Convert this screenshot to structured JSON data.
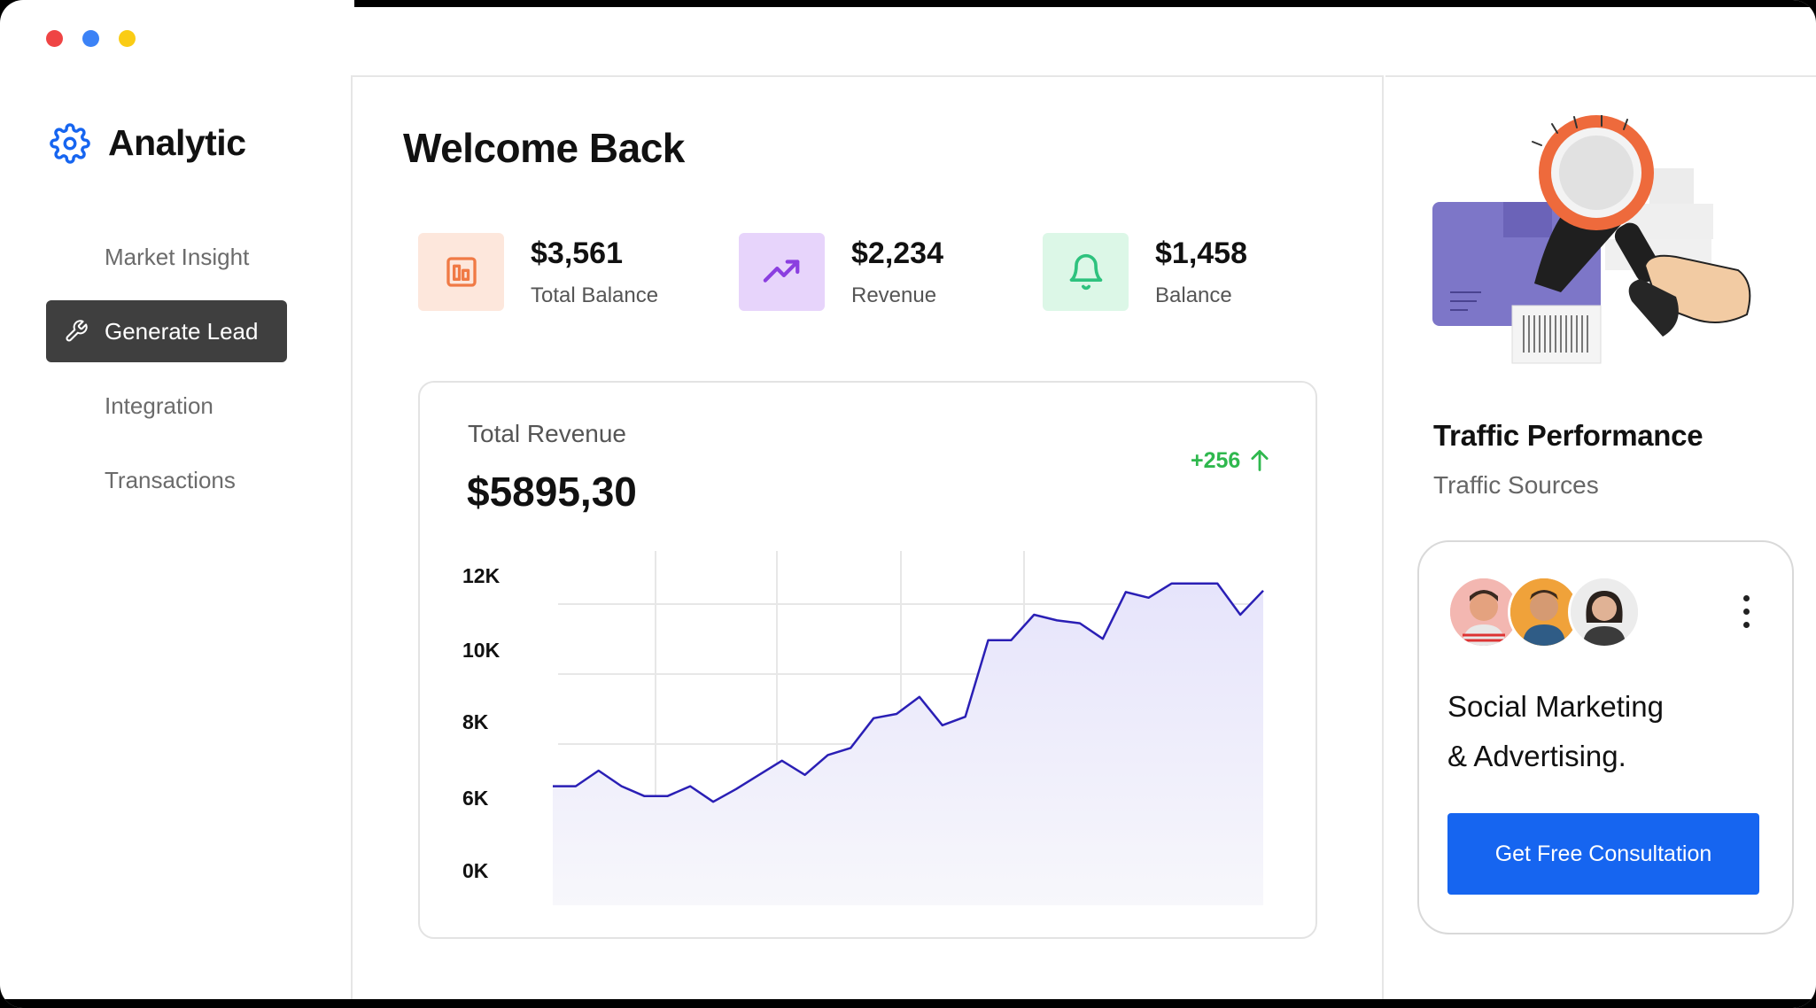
{
  "window": {
    "dot_colors": [
      "#ef4444",
      "#3b82f6",
      "#facc15"
    ]
  },
  "sidebar": {
    "brand": "Analytic",
    "items": [
      {
        "label": "Market Insight",
        "active": false
      },
      {
        "label": "Generate Lead",
        "active": true
      },
      {
        "label": "Integration",
        "active": false
      },
      {
        "label": "Transactions",
        "active": false
      }
    ]
  },
  "main": {
    "welcome": "Welcome Back",
    "stats": [
      {
        "value": "$3,561",
        "label": "Total Balance",
        "icon": "bar-chart-icon",
        "bg": "#fde7dc",
        "color": "#f07a45"
      },
      {
        "value": "$2,234",
        "label": "Revenue",
        "icon": "trending-up-icon",
        "bg": "#e7d4fb",
        "color": "#8b3fe0"
      },
      {
        "value": "$1,458",
        "label": "Balance",
        "icon": "bell-icon",
        "bg": "#dcf7e7",
        "color": "#2ec27e"
      }
    ]
  },
  "revenue_card": {
    "title": "Total Revenue",
    "total": "$5895,30",
    "change": "+256",
    "change_color": "#2fb84e"
  },
  "chart_data": {
    "type": "area",
    "ylabel": "",
    "xlabel": "",
    "y_tick_labels": [
      "12K",
      "10K",
      "8K",
      "6K",
      "0K"
    ],
    "line_color": "#2a1fb5",
    "fill_color": "#ecebfb",
    "series": [
      {
        "values": [
          4.2,
          4.2,
          4.75,
          4.2,
          3.85,
          3.85,
          4.2,
          3.65,
          4.1,
          4.6,
          5.1,
          4.6,
          5.3,
          5.55,
          6.6,
          6.75,
          7.35,
          6.35,
          6.65,
          9.35,
          9.35,
          10.25,
          10.05,
          9.95,
          9.4,
          11.05,
          10.85,
          11.35,
          11.35,
          11.35,
          10.25,
          11.1
        ]
      }
    ],
    "grid": true
  },
  "right_panel": {
    "title": "Traffic Performance",
    "subtitle": "Traffic Sources",
    "promo_line1": "Social Marketing",
    "promo_line2": "& Advertising.",
    "cta": "Get Free Consultation"
  }
}
